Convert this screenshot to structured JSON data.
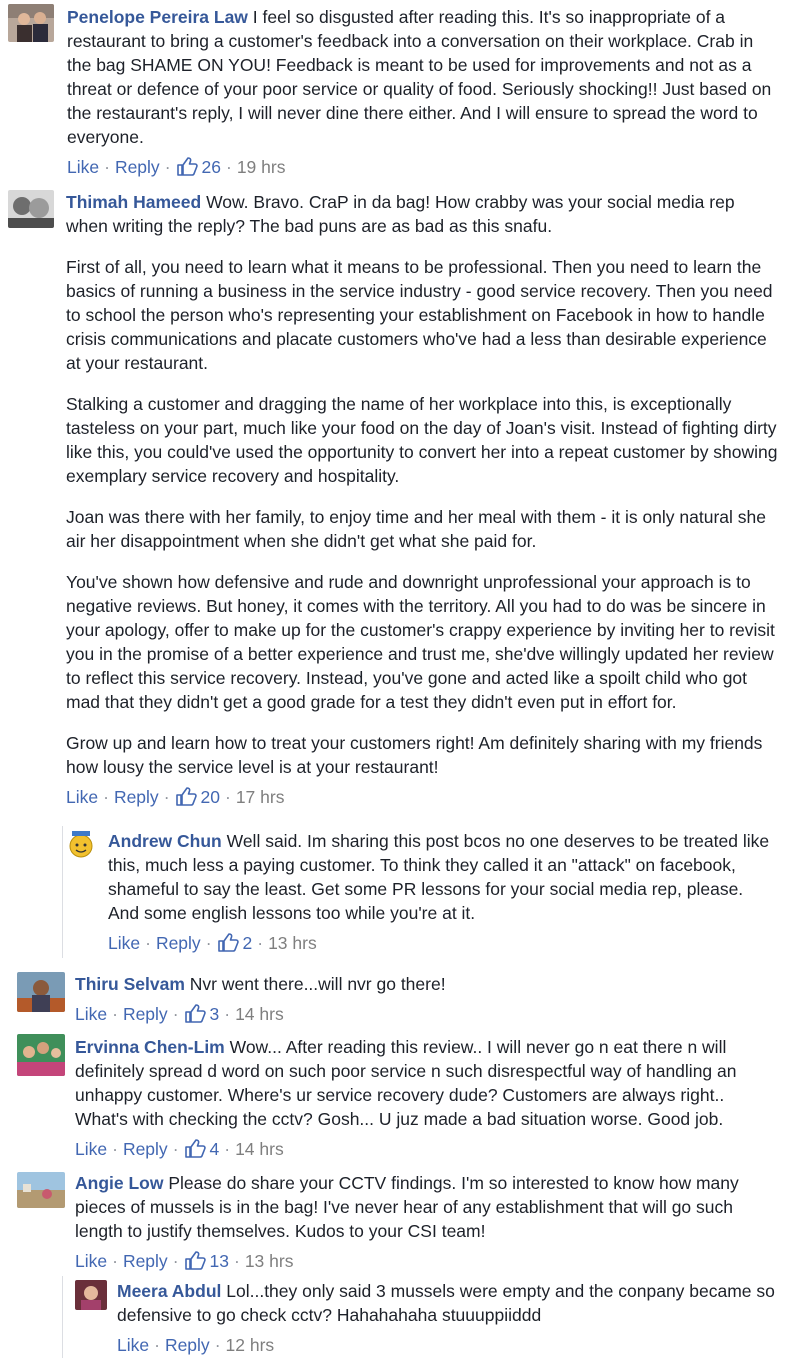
{
  "actions": {
    "like": "Like",
    "reply": "Reply",
    "sep": "·"
  },
  "comments": [
    {
      "author": "Penelope Pereira Law",
      "paragraphs": [
        "I feel so disgusted after reading this. It's so inappropriate of a restaurant to bring a customer's feedback into a conversation on their workplace. Crab in the bag SHAME ON YOU! Feedback is meant to be used for improvements and not as a threat or defence of your poor service or quality of food. Seriously shocking!! Just based on the restaurant's reply, I will never dine there either. And I will ensure to spread the word to everyone."
      ],
      "likes": "26",
      "time": "19 hrs"
    },
    {
      "author": "Thimah Hameed",
      "paragraphs": [
        "Wow. Bravo. CraP in da bag! How crabby was your social media rep when writing the reply? The bad puns are as bad as this snafu.",
        "First of all, you need to learn what it means to be professional. Then you need to learn the basics of running a business in the service industry - good service recovery. Then you need to school the person who's representing your establishment on Facebook in how to handle crisis communications and placate customers who've had a less than desirable experience at your restaurant.",
        "Stalking a customer and dragging the name of her workplace into this, is exceptionally tasteless on your part, much like your food on the day of Joan's visit. Instead of fighting dirty like this, you could've used the opportunity to convert her into a repeat customer by showing exemplary service recovery and hospitality.",
        "Joan was there with her family, to enjoy time and her meal with them - it is only natural she air her disappointment when she didn't get what she paid for.",
        "You've shown how defensive and rude and downright unprofessional your approach is to negative reviews. But honey, it comes with the territory. All you had to do was be sincere in your apology, offer to make up for the customer's crappy experience by inviting her to revisit you in the promise of a better experience and trust me, she'dve willingly updated her review to reflect this service recovery. Instead, you've gone and acted like a spoilt child who got mad that they didn't get a good grade for a test they didn't even put in effort for.",
        "Grow up and learn how to treat your customers right! Am definitely sharing with my friends how lousy the service level is at your restaurant!"
      ],
      "likes": "20",
      "time": "17 hrs"
    },
    {
      "author": "Andrew Chun",
      "paragraphs": [
        "Well said. Im sharing this post bcos no one deserves to be treated like this, much less a paying customer. To think they called it an \"attack\" on facebook, shameful to say the least. Get some PR lessons for your social media rep, please. And some english lessons too while you're at it."
      ],
      "likes": "2",
      "time": "13 hrs"
    },
    {
      "author": "Thiru Selvam",
      "paragraphs": [
        "Nvr went there...will nvr go there!"
      ],
      "likes": "3",
      "time": "14 hrs"
    },
    {
      "author": "Ervinna Chen-Lim",
      "paragraphs": [
        "Wow... After reading this review.. I will never go n eat there n will definitely spread d word on such poor service n such disrespectful way of handling an unhappy customer. Where's ur service recovery dude? Customers are always right.. What's with checking the cctv? Gosh... U juz made a bad situation worse. Good job."
      ],
      "likes": "4",
      "time": "14 hrs"
    },
    {
      "author": "Angie Low",
      "paragraphs": [
        "Please do share your CCTV findings. I'm so interested to know how many pieces of mussels is in the bag! I've never hear of any establishment that will go such length to justify themselves. Kudos to your CSI team!"
      ],
      "likes": "13",
      "time": "13 hrs"
    },
    {
      "author": "Meera Abdul",
      "paragraphs": [
        "Lol...they only said 3 mussels were empty and the conpany became so defensive to go check cctv? Hahahahaha stuuuppiiddd"
      ],
      "likes": "",
      "time": "12 hrs"
    }
  ],
  "colors": {
    "author": "#365899",
    "link": "#4267b2",
    "meta": "#90949c",
    "text": "#1d2129"
  }
}
